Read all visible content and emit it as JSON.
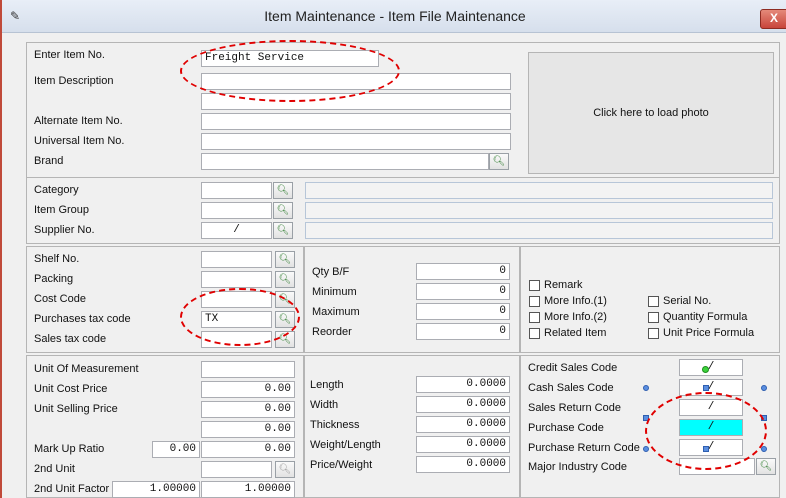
{
  "window": {
    "title": "Item Maintenance - Item File Maintenance",
    "close_label": "X"
  },
  "identity": {
    "item_no_label": "Enter Item No.",
    "item_no_value": "Freight Service",
    "description_label": "Item Description",
    "alt_item_label": "Alternate Item No.",
    "universal_item_label": "Universal Item No.",
    "brand_label": "Brand"
  },
  "photo": {
    "label": "Click here to load photo"
  },
  "classification": {
    "category_label": "Category",
    "item_group_label": "Item Group",
    "supplier_label": "Supplier No.",
    "supplier_value": "/"
  },
  "codes": {
    "shelf_label": "Shelf No.",
    "packing_label": "Packing",
    "cost_code_label": "Cost Code",
    "purchases_tax_label": "Purchases tax code",
    "purchases_tax_value": "TX",
    "sales_tax_label": "Sales tax code"
  },
  "quantities": {
    "qty_bf_label": "Qty B/F",
    "qty_bf_value": "0",
    "minimum_label": "Minimum",
    "minimum_value": "0",
    "maximum_label": "Maximum",
    "maximum_value": "0",
    "reorder_label": "Reorder",
    "reorder_value": "0"
  },
  "options": {
    "remark": "Remark",
    "more_info_1": "More Info.(1)",
    "more_info_2": "More Info.(2)",
    "related_item": "Related Item",
    "serial_no": "Serial No.",
    "quantity_formula": "Quantity Formula",
    "unit_price_formula": "Unit Price Formula"
  },
  "pricing": {
    "uom_label": "Unit Of Measurement",
    "unit_cost_label": "Unit Cost Price",
    "unit_cost_value": "0.00",
    "unit_selling_label": "Unit Selling Price",
    "unit_selling_value": "0.00",
    "extra_price_value": "0.00",
    "markup_label": "Mark Up Ratio",
    "markup_value_1": "0.00",
    "markup_value_2": "0.00",
    "second_unit_label": "2nd Unit",
    "second_unit_factor_label": "2nd Unit Factor",
    "factor_value_1": "1.00000",
    "factor_value_2": "1.00000"
  },
  "dimensions": {
    "length_label": "Length",
    "length_value": "0.0000",
    "width_label": "Width",
    "width_value": "0.0000",
    "thickness_label": "Thickness",
    "thickness_value": "0.0000",
    "weight_length_label": "Weight/Length",
    "weight_length_value": "0.0000",
    "price_weight_label": "Price/Weight",
    "price_weight_value": "0.0000"
  },
  "sales_codes": {
    "credit_sales_label": "Credit Sales Code",
    "credit_sales_value": "/",
    "cash_sales_label": "Cash Sales Code",
    "cash_sales_value": "/",
    "sales_return_label": "Sales Return Code",
    "sales_return_value": "/",
    "purchase_label": "Purchase Code",
    "purchase_value": "/",
    "purchase_return_label": "Purchase Return Code",
    "purchase_return_value": "/",
    "major_industry_label": "Major Industry Code"
  },
  "icons": {
    "lookup": "magnifier-icon",
    "window": "app-icon"
  },
  "colors": {
    "annotation": "#e00000",
    "highlight_field": "#00ffff"
  }
}
